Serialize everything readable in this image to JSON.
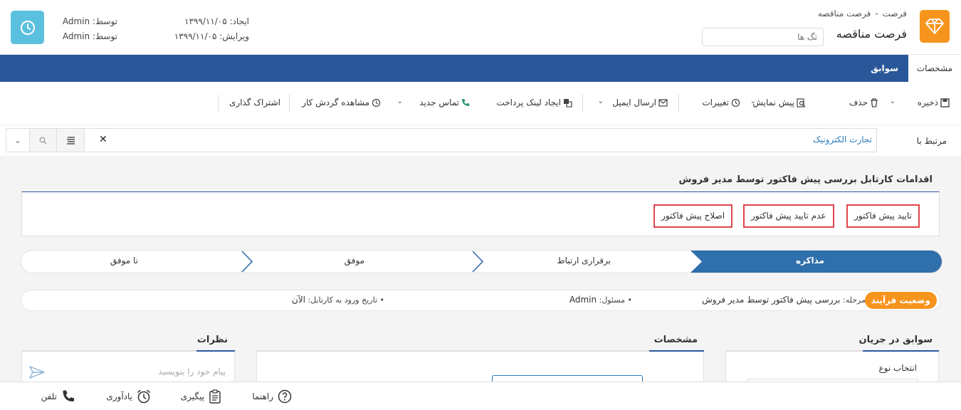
{
  "header": {
    "breadcrumb": [
      "فرصت",
      "فرصت مناقصه"
    ],
    "breadcrumb_sep": "-",
    "title": "فرصت مناقصه",
    "tags_placeholder": "تگ ها",
    "created_label": "ایجاد:",
    "created_date": "۱۳۹۹/۱۱/۰۵",
    "edited_label": "ویرایش:",
    "edited_date": "۱۳۹۹/۱۱/۰۵",
    "by_label": "توسط:",
    "created_by": "Admin",
    "edited_by": "Admin"
  },
  "tabs": {
    "specs": "مشخصات",
    "history": "سوابق"
  },
  "toolbar": {
    "save": "ذخیره",
    "delete": "حذف",
    "preview": "پیش نمایش",
    "changes": "تغییرات",
    "send_email": "ارسال ایمیل",
    "payment_link": "ایجاد لینک پرداخت",
    "new_contact": "تماس جدید",
    "workflow_view": "مشاهده گردش کار",
    "share": "اشتراک گذاری"
  },
  "related": {
    "label": "مرتبط با",
    "value": "تجارت الکترونیک"
  },
  "workflow": {
    "title": "اقدامات کارتابل بررسی پیش فاکتور توسط مدیر فروش",
    "approve": "تایید پیش فاکتور",
    "reject": "عدم تایید پیش فاکتور",
    "revise": "اصلاح پیش فاکتور"
  },
  "stages": {
    "negotiation": "مذاکره",
    "contact": "برقراری ارتباط",
    "success": "موفق",
    "failed": "نا موفق"
  },
  "process": {
    "badge": "وضعیت فرآیند",
    "stage_label": "مرحله:",
    "stage_value": "بررسی پیش فاکتور توسط مدیر فروش",
    "owner_label": "• مسئول:",
    "owner_value": "Admin",
    "entry_label": "• تاریخ ورود به کارتابل:",
    "entry_value": "الآن"
  },
  "panels": {
    "history_title": "سوابق در جریان",
    "history_select_type": "انتخاب نوع",
    "specs_title": "مشخصات",
    "comments_title": "نظرات",
    "comment_placeholder": "پیام خود را بنویسید"
  },
  "footer": {
    "help": "راهنما",
    "followup": "پیگیری",
    "reminder": "یادآوری",
    "phone": "تلفن"
  },
  "colors": {
    "brand_orange": "#f7941d",
    "nav_blue": "#2a579a",
    "stage_blue": "#2f6fab",
    "highlight_red": "#e0444b",
    "clock_cyan": "#5bc0de"
  }
}
